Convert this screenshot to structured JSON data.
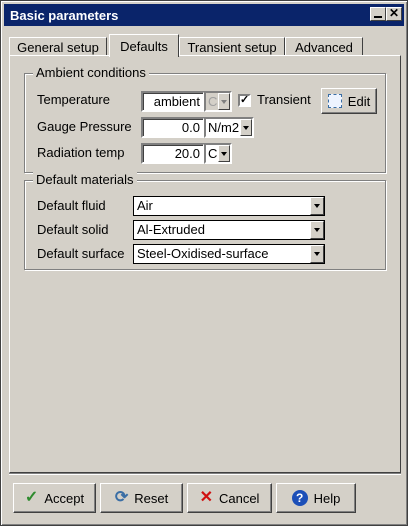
{
  "window": {
    "title": "Basic parameters"
  },
  "tabs": [
    {
      "label": "General setup"
    },
    {
      "label": "Defaults"
    },
    {
      "label": "Transient setup"
    },
    {
      "label": "Advanced"
    }
  ],
  "ambient": {
    "group_title": "Ambient conditions",
    "temperature": {
      "label": "Temperature",
      "value": "ambient",
      "unit": "C"
    },
    "transient": {
      "label": "Transient",
      "checked_mark": "✓"
    },
    "edit_label": "Edit",
    "gauge_pressure": {
      "label": "Gauge Pressure",
      "value": "0.0",
      "unit": "N/m2"
    },
    "radiation_temp": {
      "label": "Radiation temp",
      "value": "20.0",
      "unit": "C"
    }
  },
  "materials": {
    "group_title": "Default materials",
    "fluid": {
      "label": "Default fluid",
      "value": "Air"
    },
    "solid": {
      "label": "Default solid",
      "value": "Al-Extruded"
    },
    "surface": {
      "label": "Default surface",
      "value": "Steel-Oxidised-surface"
    }
  },
  "buttons": {
    "accept": "Accept",
    "reset": "Reset",
    "cancel": "Cancel",
    "help": "Help"
  },
  "colors": {
    "titlebar": "#0a246a",
    "accept_icon": "#2e8b2e",
    "reset_icon": "#3a6ea5",
    "cancel_icon": "#d01010",
    "help_icon": "#1c4fb8"
  }
}
